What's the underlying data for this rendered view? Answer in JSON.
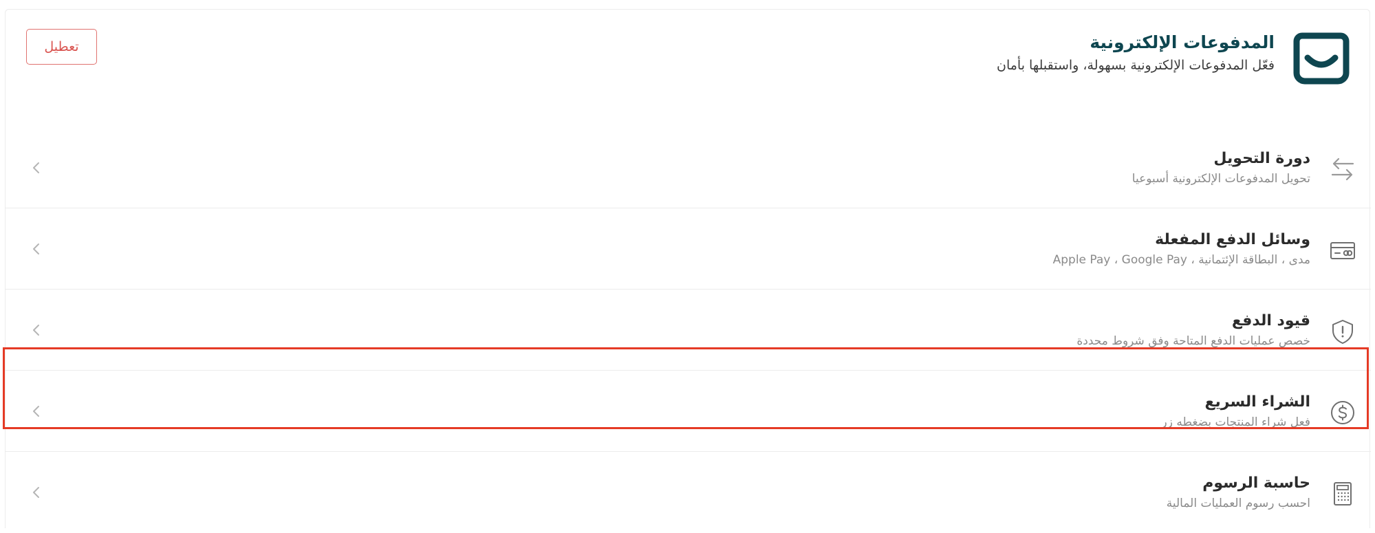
{
  "header": {
    "title": "المدفوعات الإلكترونية",
    "subtitle": "فعّل المدفوعات الإلكترونية بسهولة، واستقبلها بأمان",
    "disable_label": "تعطيل",
    "logo_icon": "salla-bag-logo-icon",
    "logo_color": "#0e4650"
  },
  "settings": {
    "items": [
      {
        "title": "دورة التحويل",
        "subtitle": "تحويل المدفوعات الإلكترونية أسبوعيا",
        "icon": "transfer-arrows-icon"
      },
      {
        "title": "وسائل الدفع المفعلة",
        "subtitle": "مدى ، البطاقة الإئتمانية ، Apple Pay ، Google Pay",
        "icon": "payment-card-icon"
      },
      {
        "title": "قيود الدفع",
        "subtitle": "خصص عمليات الدفع المتاحة وفق شروط محددة",
        "icon": "shield-alert-icon"
      },
      {
        "title": "الشراء السريع",
        "subtitle": "فعل شراء المنتجات بضغطه زر",
        "icon": "dollar-circle-icon",
        "highlighted": true
      },
      {
        "title": "حاسبة الرسوم",
        "subtitle": "احسب رسوم العمليات المالية",
        "icon": "calculator-icon"
      }
    ]
  },
  "colors": {
    "brand": "#0e4650",
    "danger": "#d9534f",
    "highlight": "#e53a25",
    "muted_text": "#8a8a8a"
  }
}
